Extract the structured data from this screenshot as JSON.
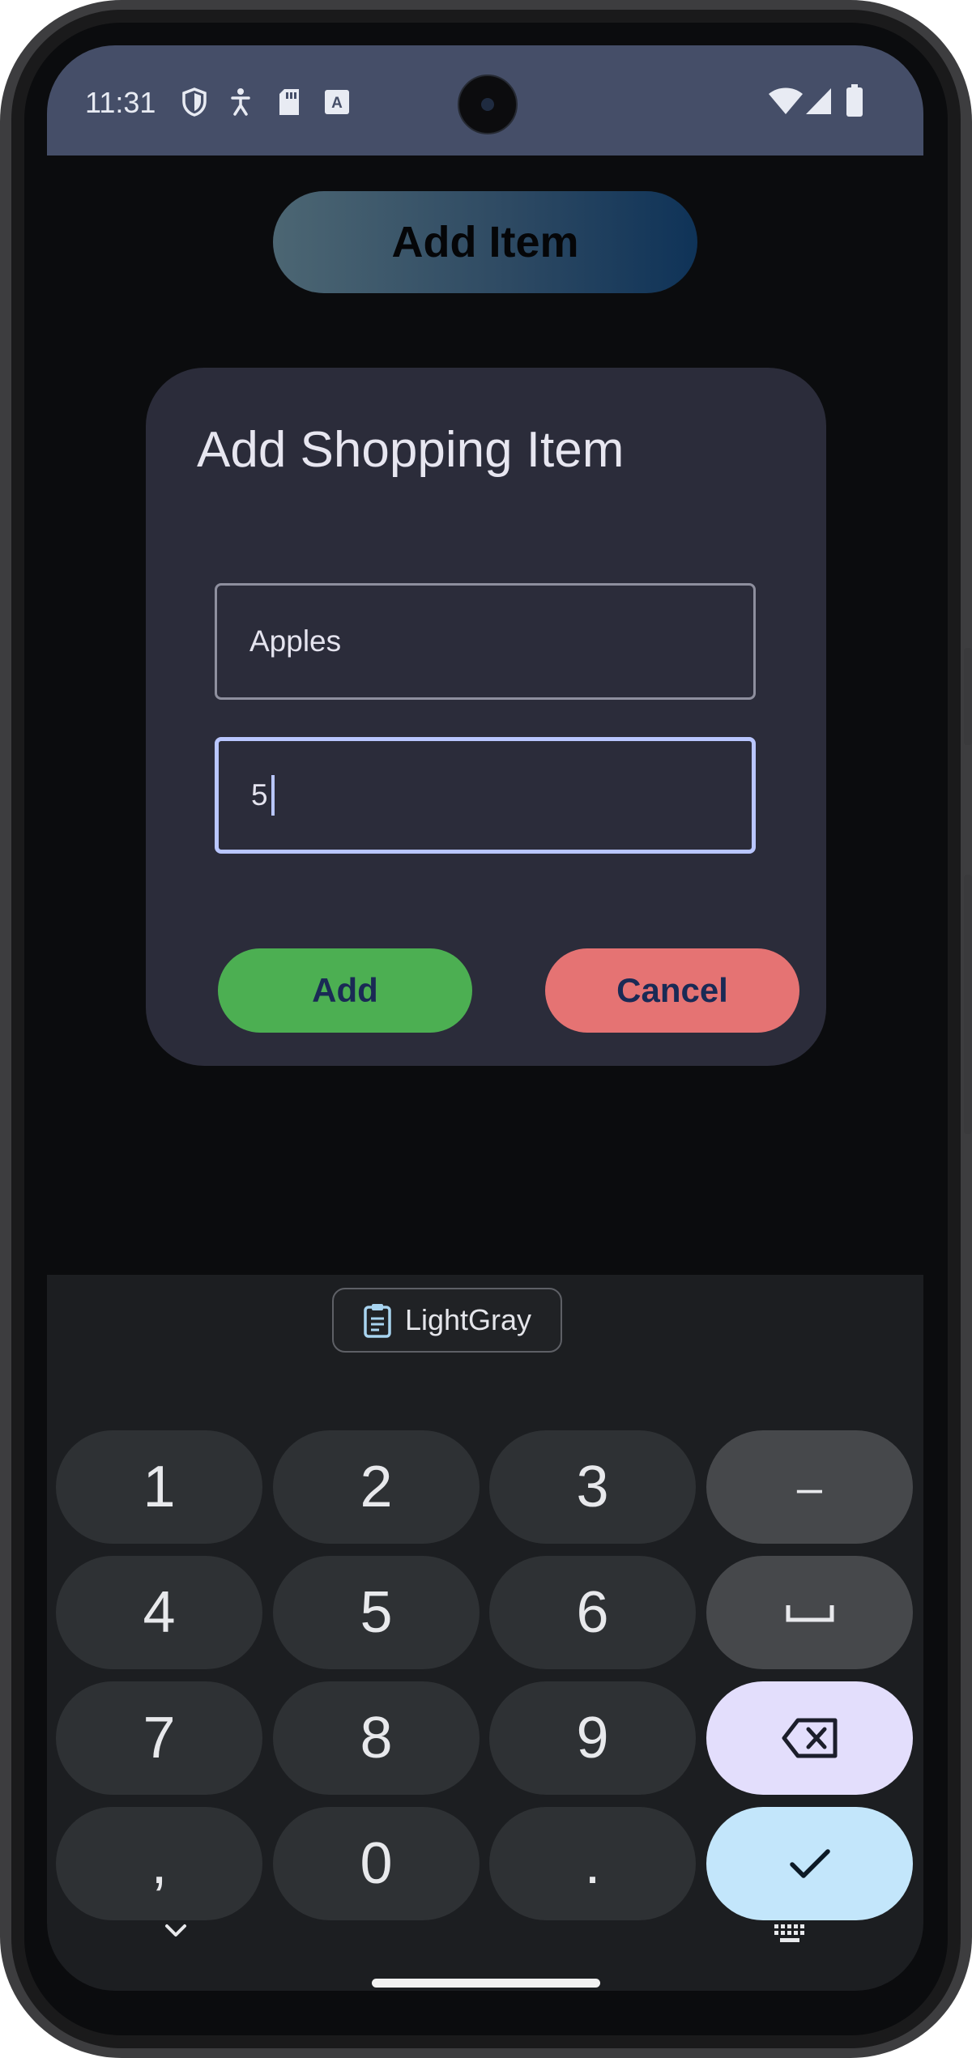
{
  "status_bar": {
    "time": "11:31",
    "left_icons": [
      "shield-icon",
      "accessibility-icon",
      "sd-card-icon",
      "font-icon"
    ],
    "right_icons": [
      "wifi-icon",
      "cellular-signal-icon",
      "battery-icon"
    ]
  },
  "app": {
    "add_item_button_label": "Add Item"
  },
  "dialog": {
    "title": "Add Shopping Item",
    "name_field_value": "Apples",
    "quantity_field_value": "5",
    "add_button_label": "Add",
    "cancel_button_label": "Cancel"
  },
  "keyboard": {
    "clipboard_suggestion": "LightGray",
    "keys": {
      "k1": "1",
      "k2": "2",
      "k3": "3",
      "minus": "–",
      "k4": "4",
      "k5": "5",
      "k6": "6",
      "k7": "7",
      "k8": "8",
      "k9": "9",
      "comma": ",",
      "k0": "0",
      "period": "."
    },
    "special_keys": [
      "space-icon",
      "backspace-icon",
      "checkmark-icon"
    ]
  },
  "colors": {
    "status_bar": "#454e68",
    "dialog_bg": "#2b2c3a",
    "add_button": "#4caf52",
    "cancel_button": "#e57373",
    "focus_border": "#b9c6ff"
  }
}
